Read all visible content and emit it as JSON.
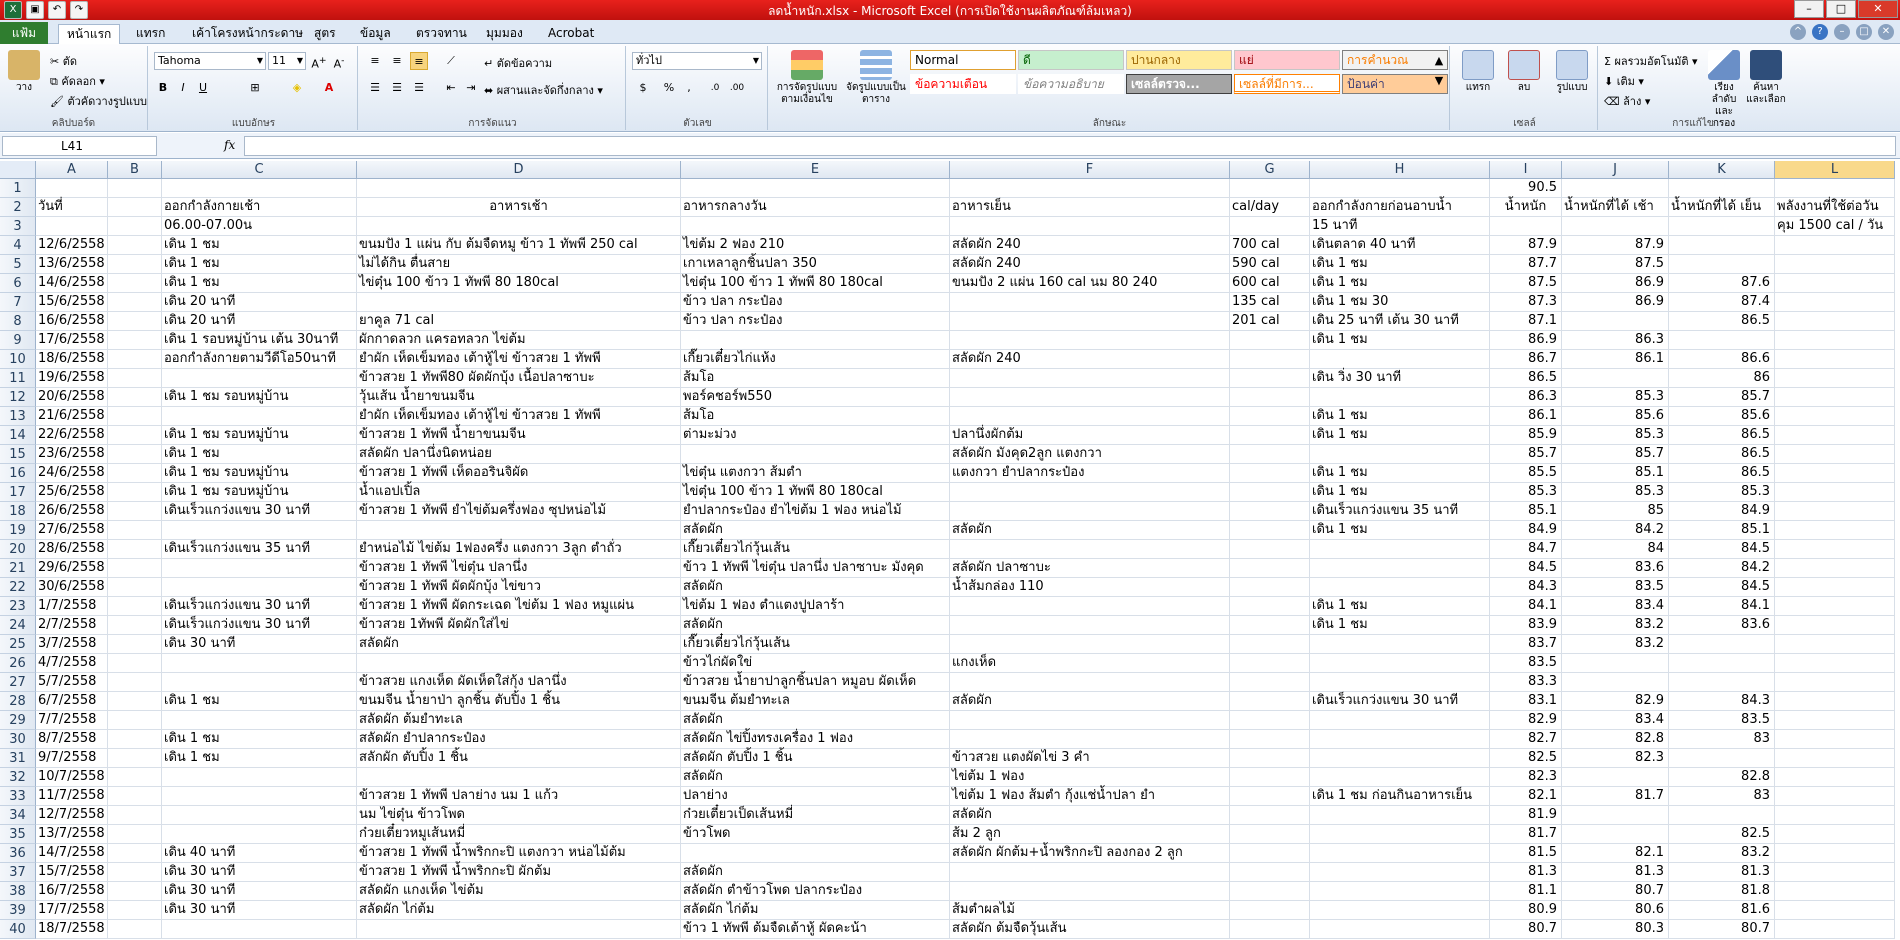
{
  "window": {
    "title": "ลดน้ำหนัก.xlsx - Microsoft Excel (การเปิดใช้งานผลิตภัณฑ์ล้มเหลว)"
  },
  "tabs": {
    "file": "แฟ้ม",
    "items": [
      "หน้าแรก",
      "แทรก",
      "เค้าโครงหน้ากระดาษ",
      "สูตร",
      "ข้อมูล",
      "ตรวจทาน",
      "มุมมอง",
      "Acrobat"
    ]
  },
  "ribbon": {
    "clipboard": {
      "paste": "วาง",
      "cut": "ตัด",
      "copy": "คัดลอก",
      "format_painter": "ตัวคัดวางรูปแบบ",
      "label": "คลิปบอร์ด"
    },
    "font": {
      "name": "Tahoma",
      "size": "11",
      "bold": "B",
      "italic": "I",
      "underline": "U",
      "label": "แบบอักษร"
    },
    "alignment": {
      "wrap": "ตัดข้อความ",
      "merge": "ผสานและจัดกึ่งกลาง",
      "label": "การจัดแนว"
    },
    "number": {
      "format": "ทั่วไป",
      "label": "ตัวเลข"
    },
    "styles": {
      "conditional": "การจัดรูปแบบตามเงื่อนไข",
      "format_table": "จัดรูปแบบเป็นตาราง",
      "cells": [
        {
          "text": "Normal",
          "bg": "#ffffff",
          "fg": "#000000",
          "border": "#e0a030"
        },
        {
          "text": "ดี",
          "bg": "#c6efce",
          "fg": "#006100",
          "border": "#c6c6c6"
        },
        {
          "text": "ปานกลาง",
          "bg": "#ffeb9c",
          "fg": "#9c6500",
          "border": "#c6c6c6"
        },
        {
          "text": "แย่",
          "bg": "#ffc7ce",
          "fg": "#9c0006",
          "border": "#c6c6c6"
        },
        {
          "text": "การคำนวณ",
          "bg": "#f2f2f2",
          "fg": "#fa7d00",
          "border": "#7f7f7f"
        },
        {
          "text": "ข้อความเตือน",
          "bg": "#ffffff",
          "fg": "#ff0000",
          "border": "#ffffff"
        },
        {
          "text": "ข้อความอธิบาย",
          "bg": "#ffffff",
          "fg": "#7f7f7f",
          "border": "#ffffff"
        },
        {
          "text": "เซลล์ตรวจ...",
          "bg": "#a5a5a5",
          "fg": "#ffffff",
          "border": "#3f3f3f"
        },
        {
          "text": "เซลล์ที่มีการ...",
          "bg": "#ffffff",
          "fg": "#fa7d00",
          "border": "#ff8001"
        },
        {
          "text": "ป้อนค่า",
          "bg": "#ffcc99",
          "fg": "#3f3f76",
          "border": "#7f7f7f"
        }
      ],
      "label": "ลักษณะ"
    },
    "cells": {
      "insert": "แทรก",
      "delete": "ลบ",
      "format": "รูปแบบ",
      "label": "เซลล์"
    },
    "editing": {
      "autosum": "ผลรวมอัตโนมัติ",
      "fill": "เติม",
      "clear": "ล้าง",
      "sort": "เรียงลำดับและกรอง",
      "find": "ค้นหาและเลือก",
      "label": "การแก้ไข"
    }
  },
  "formula_bar": {
    "name_box": "L41",
    "fx": "fx",
    "content": ""
  },
  "sheet": {
    "columns": [
      {
        "id": "A"
      },
      {
        "id": "B"
      },
      {
        "id": "C"
      },
      {
        "id": "D"
      },
      {
        "id": "E"
      },
      {
        "id": "F"
      },
      {
        "id": "G"
      },
      {
        "id": "H"
      },
      {
        "id": "I"
      },
      {
        "id": "J"
      },
      {
        "id": "K"
      },
      {
        "id": "L"
      }
    ],
    "selected_column": "L",
    "rows": [
      [
        "1",
        "",
        "",
        "",
        "",
        "",
        "",
        "",
        "",
        "90.5",
        "",
        "",
        ""
      ],
      [
        "2",
        "วันที่",
        "",
        "ออกกำลังกายเช้า",
        "อาหารเช้า",
        "อาหารกลางวัน",
        "อาหารเย็น",
        "cal/day",
        "ออกกำลังกายก่อนอาบน้ำ",
        "น้ำหนัก",
        "น้ำหนักที่ได้ เช้า",
        "น้ำหนักที่ได้ เย็น",
        "พลังงานที่ใช้ต่อวัน"
      ],
      [
        "3",
        "",
        "",
        "06.00-07.00น",
        "",
        "",
        "",
        "",
        "15 นาที",
        "",
        "",
        "",
        "คุม 1500 cal / วัน"
      ],
      [
        "4",
        "12/6/2558",
        "",
        "เดิน 1 ชม",
        "ขนมปัง 1 แผ่น กับ ต้มจืดหมู ข้าว 1 ทัพพี 250 cal",
        "ไข่ต้ม 2 ฟอง 210",
        "สลัดผัก 240",
        "700 cal",
        "เดินตลาด 40 นาที",
        "87.9",
        "87.9",
        "",
        ""
      ],
      [
        "5",
        "13/6/2558",
        "",
        "เดิน 1 ชม",
        "ไม่ได้กิน ตื่นสาย",
        "เกาเหลาลูกชิ้นปลา 350",
        "สลัดผัก 240",
        "590 cal",
        "เดิน 1 ชม",
        "87.7",
        "87.5",
        "",
        ""
      ],
      [
        "6",
        "14/6/2558",
        "",
        "เดิน 1 ชม",
        "ไข่ตุ๋น 100 ข้าว 1 ทัพพี 80 180cal",
        "ไข่ตุ๋น 100 ข้าว 1 ทัพพี 80 180cal",
        "ขนมปัง 2 แผ่น 160 cal นม 80 240",
        "600 cal",
        "เดิน 1 ชม",
        "87.5",
        "86.9",
        "87.6",
        ""
      ],
      [
        "7",
        "15/6/2558",
        "",
        "เดิน 20 นาที",
        "",
        "ข้าว ปลา กระป๋อง",
        "",
        "135 cal",
        "เดิน 1 ชม 30",
        "87.3",
        "86.9",
        "87.4",
        ""
      ],
      [
        "8",
        "16/6/2558",
        "",
        "เดิน 20 นาที",
        "ยาคูล 71 cal",
        "ข้าว ปลา กระป๋อง",
        "",
        "201 cal",
        "เดิน 25 นาที เต้น 30 นาที",
        "87.1",
        "",
        "86.5",
        ""
      ],
      [
        "9",
        "17/6/2558",
        "",
        "เดิน 1 รอบหมู่บ้าน เต้น 30นาที",
        "ผักกาดลวก แครอทลวก ไข่ต้ม",
        "",
        "",
        "",
        "เดิน 1 ชม",
        "86.9",
        "86.3",
        "",
        ""
      ],
      [
        "10",
        "18/6/2558",
        "",
        "ออกกำลังกายตามวีดีโอ50นาที",
        "ยำผัก เห็ดเข็มทอง เต้าหู้ไข่ ข้าวสวย 1 ทัพพี",
        "เกี๊ยวเตี๋ยวไก่แห้ง",
        "สลัดผัก 240",
        "",
        "",
        "86.7",
        "86.1",
        "86.6",
        ""
      ],
      [
        "11",
        "19/6/2558",
        "",
        "",
        "ข้าวสวย 1 ทัพพี80 ผัดผักบุ้ง เนื้อปลาซาบะ",
        "ส้มโอ",
        "",
        "",
        "เดิน วิ่ง 30 นาที",
        "86.5",
        "",
        "86",
        ""
      ],
      [
        "12",
        "20/6/2558",
        "",
        "เดิน 1 ชม รอบหมู่บ้าน",
        "วุ้นเส้น น้ำยาขนมจีน",
        "พอร์คชอร์พ550",
        "",
        "",
        "",
        "86.3",
        "85.3",
        "85.7",
        ""
      ],
      [
        "13",
        "21/6/2558",
        "",
        "",
        "ยำผัก เห็ดเข็มทอง เต้าหู้ไข่ ข้าวสวย 1 ทัพพี",
        "ส้มโอ",
        "",
        "",
        "เดิน 1 ชม",
        "86.1",
        "85.6",
        "85.6",
        ""
      ],
      [
        "14",
        "22/6/2558",
        "",
        "เดิน 1 ชม รอบหมู่บ้าน",
        "ข้าวสวย 1 ทัพพี น้ำยาขนมจีน",
        "ต่ามะม่วง",
        "ปลานึ่งผักต้ม",
        "",
        "เดิน 1 ชม",
        "85.9",
        "85.3",
        "86.5",
        ""
      ],
      [
        "15",
        "23/6/2558",
        "",
        "เดิน 1 ชม",
        "สลัดผัก ปลานึ่งนิดหน่อย",
        "",
        "สลัดผัก มังคุด2ลูก แตงกวา",
        "",
        "",
        "85.7",
        "85.7",
        "86.5",
        ""
      ],
      [
        "16",
        "24/6/2558",
        "",
        "เดิน 1 ชม รอบหมู่บ้าน",
        "ข้าวสวย 1 ทัพพี เห็ดออรินจิผัด",
        "ไข่ตุ๋น แตงกวา ส้มตำ",
        "แตงกวา ยำปลากระป๋อง",
        "",
        "เดิน 1 ชม",
        "85.5",
        "85.1",
        "86.5",
        ""
      ],
      [
        "17",
        "25/6/2558",
        "",
        "เดิน 1 ชม รอบหมู่บ้าน",
        "น้ำแอปเปิ้ล",
        "ไข่ตุ๋น 100 ข้าว 1 ทัพพี 80 180cal",
        "",
        "",
        "เดิน 1 ชม",
        "85.3",
        "85.3",
        "85.3",
        ""
      ],
      [
        "18",
        "26/6/2558",
        "",
        "เดินเร็วแกว่งแขน 30 นาที",
        "ข้าวสวย 1 ทัพพี ยำไข่ต้มครึ่งฟอง ซุปหน่อไม้",
        "ยำปลากระป๋อง ยำไข่ต้ม 1 ฟอง หน่อไม้",
        "",
        "",
        "เดินเร็วแกว่งแขน 35 นาที",
        "85.1",
        "85",
        "84.9",
        ""
      ],
      [
        "19",
        "27/6/2558",
        "",
        "",
        "",
        "สลัดผัก",
        "สลัดผัก",
        "",
        "เดิน 1 ชม",
        "84.9",
        "84.2",
        "85.1",
        ""
      ],
      [
        "20",
        "28/6/2558",
        "",
        "เดินเร็วแกว่งแขน 35 นาที",
        "ยำหน่อไม้ ไข่ต้ม 1ฟองครึ่ง แตงกวา 3ลูก ตำถั่ว",
        "เกี๊ยวเตี๋ยวไก่วุ้นเส้น",
        "",
        "",
        "",
        "84.7",
        "84",
        "84.5",
        ""
      ],
      [
        "21",
        "29/6/2558",
        "",
        "",
        "ข้าวสวย 1 ทัพพี ไข่ตุ๋น ปลานึ่ง",
        "ข้าว 1 ทัพพี ไข่ตุ๋น ปลานึ่ง ปลาซาบะ มังคุด",
        "สลัดผัก ปลาซาบะ",
        "",
        "",
        "84.5",
        "83.6",
        "84.2",
        ""
      ],
      [
        "22",
        "30/6/2558",
        "",
        "",
        "ข้าวสวย 1 ทัพพี ผัดผักบุ้ง ไข่ขาว",
        "สลัดผัก",
        "น้ำส้มกล่อง 110",
        "",
        "",
        "84.3",
        "83.5",
        "84.5",
        ""
      ],
      [
        "23",
        "1/7/2558",
        "",
        "เดินเร็วแกว่งแขน 30 นาที",
        "ข้าวสวย 1 ทัพพี ผัดกระเฉด ไข่ต้ม 1 ฟอง หมูแผ่น",
        "ไข่ต้ม 1 ฟอง ตำแตงปูปลาร้า",
        "",
        "",
        "เดิน 1 ชม",
        "84.1",
        "83.4",
        "84.1",
        ""
      ],
      [
        "24",
        "2/7/2558",
        "",
        "เดินเร็วแกว่งแขน 30 นาที",
        "ข้าวสวย 1ทัพพี ผัดผักใส่ไข่",
        "สลัดผัก",
        "",
        "",
        "เดิน 1 ชม",
        "83.9",
        "83.2",
        "83.6",
        ""
      ],
      [
        "25",
        "3/7/2558",
        "",
        "เดิน 30 นาที",
        "สลัดผัก",
        "เกี๊ยวเตี๋ยวไก่วุ้นเส้น",
        "",
        "",
        "",
        "83.7",
        "83.2",
        "",
        ""
      ],
      [
        "26",
        "4/7/2558",
        "",
        "",
        "",
        "ข้าวไก่ผัดใข่",
        "แกงเห็ด",
        "",
        "",
        "83.5",
        "",
        "",
        ""
      ],
      [
        "27",
        "5/7/2558",
        "",
        "",
        "ข้าวสวย แกงเห็ด ผัดเห็ดใส่กุ้ง ปลานึ่ง",
        "ข้าวสวย น้ำยาปาลูกชิ้นปลา หมูอบ ผัดเห็ด",
        "",
        "",
        "",
        "83.3",
        "",
        "",
        ""
      ],
      [
        "28",
        "6/7/2558",
        "",
        "เดิน 1 ชม",
        "ขนมจีน น้ำยาป่า ลูกชิ้น ตับปิ้ง 1 ชิ้น",
        "ขนมจีน ต้มยำทะเล",
        "สลัดผัก",
        "",
        "เดินเร็วแกว่งแขน 30 นาที",
        "83.1",
        "82.9",
        "84.3",
        ""
      ],
      [
        "29",
        "7/7/2558",
        "",
        "",
        "สลัดผัก ต้มยำทะเล",
        "สลัดผัก",
        "",
        "",
        "",
        "82.9",
        "83.4",
        "83.5",
        ""
      ],
      [
        "30",
        "8/7/2558",
        "",
        "เดิน 1 ชม",
        "สลัดผัก ยำปลากระป๋อง",
        "สลัดผัก ไข่ปิ้งทรงเครื่อง 1 ฟอง",
        "",
        "",
        "",
        "82.7",
        "82.8",
        "83",
        ""
      ],
      [
        "31",
        "9/7/2558",
        "",
        "เดิน 1 ชม",
        "สลักผัก ตับปิ้ง 1 ชิ้น",
        "สลัดผัก ตับปิ้ง 1 ชิ้น",
        "ข้าวสวย แตงผัดไข่ 3 คำ",
        "",
        "",
        "82.5",
        "82.3",
        "",
        ""
      ],
      [
        "32",
        "10/7/2558",
        "",
        "",
        "",
        "สลัดผัก",
        "ไข่ต้ม 1 ฟอง",
        "",
        "",
        "82.3",
        "",
        "82.8",
        ""
      ],
      [
        "33",
        "11/7/2558",
        "",
        "",
        "ข้าวสวย 1 ทัพพี ปลาย่าง นม 1 แก้ว",
        "ปลาย่าง",
        "ไข่ต้ม 1 ฟอง ส้มตำ กุ้งแช่น้ำปลา ยำ",
        "",
        "เดิน 1 ชม ก่อนกินอาหารเย็น",
        "82.1",
        "81.7",
        "83",
        ""
      ],
      [
        "34",
        "12/7/2558",
        "",
        "",
        "นม ไข่ตุ๋น ข้าวโพด",
        "ก๋วยเตี๋ยวเป็ดเส้นหมี่",
        "สลัดผัก",
        "",
        "",
        "81.9",
        "",
        "",
        ""
      ],
      [
        "35",
        "13/7/2558",
        "",
        "",
        "ก๋วยเตี๋ยวหมูเส้นหมี่",
        "ข้าวโพด",
        "ส้ม 2 ลูก",
        "",
        "",
        "81.7",
        "",
        "82.5",
        ""
      ],
      [
        "36",
        "14/7/2558",
        "",
        "เดิน 40 นาที",
        "ข้าวสวย 1 ทัพพี น้ำพริกกะปิ แตงกวา หน่อไม้ต้ม",
        "",
        "สลัดผัก ผักต้ม+น้ำพริกกะปิ ลองกอง 2 ลูก",
        "",
        "",
        "81.5",
        "82.1",
        "83.2",
        ""
      ],
      [
        "37",
        "15/7/2558",
        "",
        "เดิน 30 นาที",
        "ข้าวสวย 1 ทัพพี น้ำพริกกะปิ ผักต้ม",
        "สลัดผัก",
        "",
        "",
        "",
        "81.3",
        "81.3",
        "81.3",
        ""
      ],
      [
        "38",
        "16/7/2558",
        "",
        "เดิน 30 นาที",
        "สลัดผัก แกงเห็ด ไข่ต้ม",
        "สลัดผัก ตำข้าวโพด ปลากระป๋อง",
        "",
        "",
        "",
        "81.1",
        "80.7",
        "81.8",
        ""
      ],
      [
        "39",
        "17/7/2558",
        "",
        "เดิน 30 นาที",
        "สลัดผัก ไก่ต้ม",
        "สลัดผัก ไก่ต้ม",
        "ส้มตำผลไม้",
        "",
        "",
        "80.9",
        "80.6",
        "81.6",
        ""
      ],
      [
        "40",
        "18/7/2558",
        "",
        "",
        "",
        "ข้าว 1 ทัพพี ต้มจืดเต้าหู้ ผัดคะน้า",
        "สลัดผัก ต้มจืดวุ้นเส้น",
        "",
        "",
        "80.7",
        "80.3",
        "80.7",
        ""
      ]
    ]
  }
}
